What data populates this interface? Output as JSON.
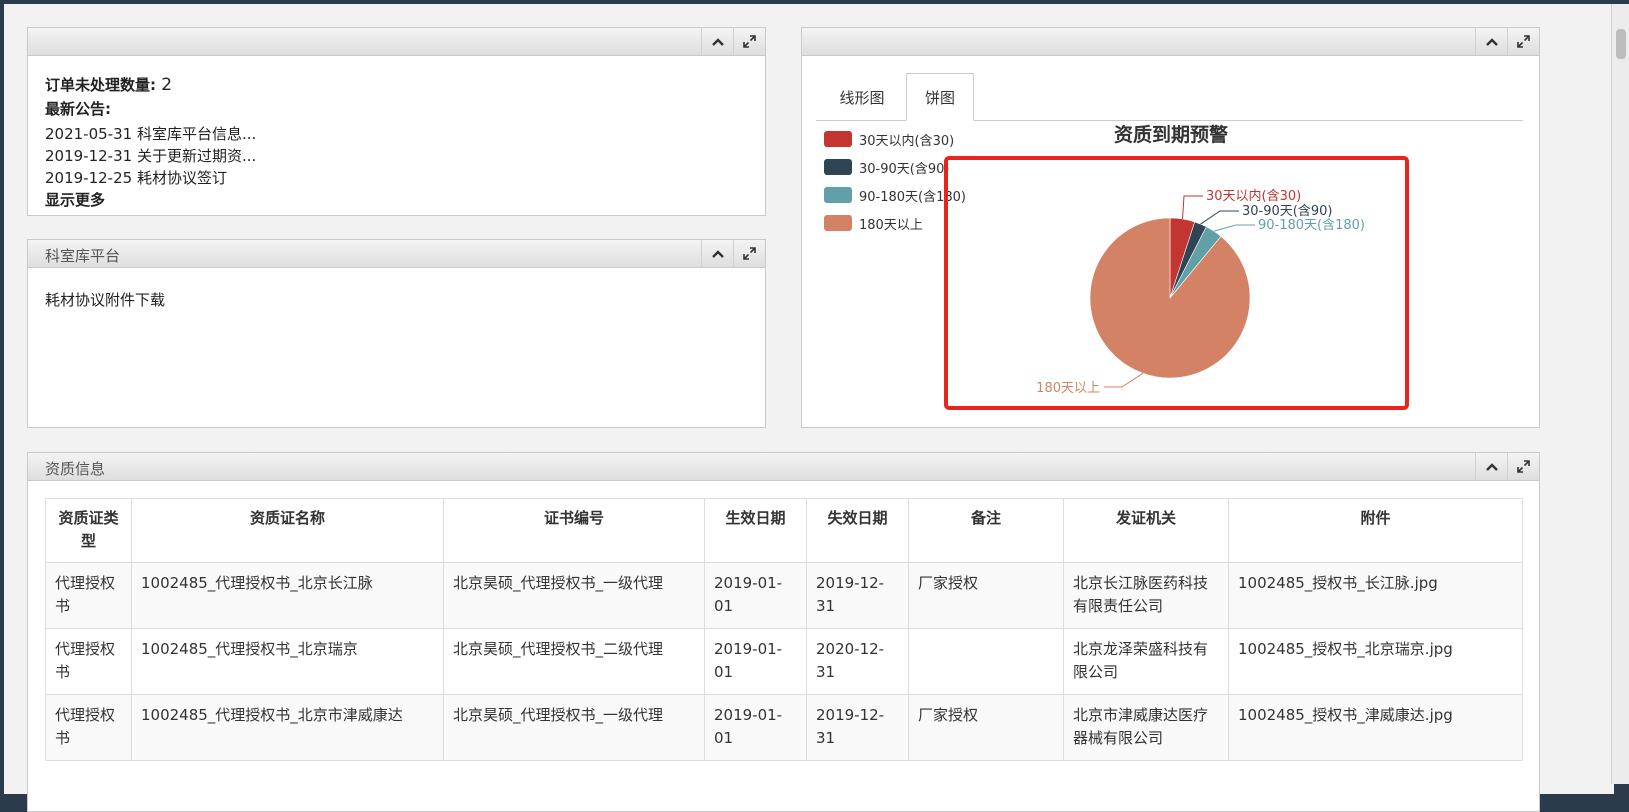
{
  "notice_panel": {
    "title": "",
    "pending_label": "订单未处理数量:",
    "pending_count": "2",
    "announce_label": "最新公告:",
    "announcements": [
      "2021-05-31 科室库平台信息...",
      "2019-12-31 关于更新过期资...",
      "2019-12-25 耗材协议签订"
    ],
    "show_more": "显示更多"
  },
  "platform_panel": {
    "title": "科室库平台",
    "link": "耗材协议附件下载"
  },
  "chart_panel": {
    "title": "",
    "tabs": [
      "线形图",
      "饼图"
    ],
    "active_tab": "饼图"
  },
  "chart_data": {
    "type": "pie",
    "title": "资质到期预警",
    "legend_position": "top-left",
    "slices": [
      {
        "label": "30天以内(含30)",
        "value": 5,
        "color": "#c23531"
      },
      {
        "label": "30-90天(含90)",
        "value": 2.5,
        "color": "#2f4554"
      },
      {
        "label": "90-180天(含180)",
        "value": 3.5,
        "color": "#61a0a8"
      },
      {
        "label": "180天以上",
        "value": 89,
        "color": "#d48265"
      }
    ]
  },
  "qualification_panel": {
    "title": "资质信息",
    "columns": [
      "资质证类型",
      "资质证名称",
      "证书编号",
      "生效日期",
      "失效日期",
      "备注",
      "发证机关",
      "附件"
    ],
    "rows": [
      [
        "代理授权书",
        "1002485_代理授权书_北京长江脉",
        "北京昊硕_代理授权书_一级代理",
        "2019-01-01",
        "2019-12-31",
        "厂家授权",
        "北京长江脉医药科技有限责任公司",
        "1002485_授权书_长江脉.jpg"
      ],
      [
        "代理授权书",
        "1002485_代理授权书_北京瑞京",
        "北京昊硕_代理授权书_二级代理",
        "2019-01-01",
        "2020-12-31",
        "",
        "北京龙泽荣盛科技有限公司",
        "1002485_授权书_北京瑞京.jpg"
      ],
      [
        "代理授权书",
        "1002485_代理授权书_北京市津威康达",
        "北京昊硕_代理授权书_一级代理",
        "2019-01-01",
        "2019-12-31",
        "厂家授权",
        "北京市津威康达医疗器械有限公司",
        "1002485_授权书_津威康达.jpg"
      ]
    ]
  },
  "icons": {
    "collapse": "chevron-up-icon",
    "expand": "expand-icon"
  },
  "colors": {
    "highlight_box": "#e8241c"
  }
}
